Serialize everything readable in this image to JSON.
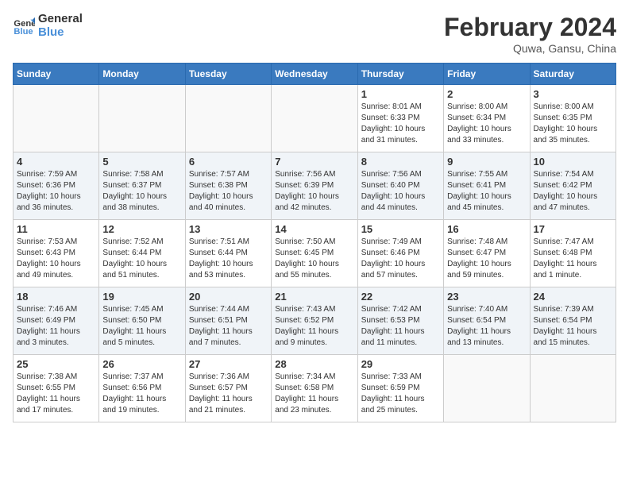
{
  "header": {
    "logo_line1": "General",
    "logo_line2": "Blue",
    "month_year": "February 2024",
    "location": "Quwa, Gansu, China"
  },
  "days_of_week": [
    "Sunday",
    "Monday",
    "Tuesday",
    "Wednesday",
    "Thursday",
    "Friday",
    "Saturday"
  ],
  "weeks": [
    [
      {
        "day": "",
        "info": ""
      },
      {
        "day": "",
        "info": ""
      },
      {
        "day": "",
        "info": ""
      },
      {
        "day": "",
        "info": ""
      },
      {
        "day": "1",
        "info": "Sunrise: 8:01 AM\nSunset: 6:33 PM\nDaylight: 10 hours\nand 31 minutes."
      },
      {
        "day": "2",
        "info": "Sunrise: 8:00 AM\nSunset: 6:34 PM\nDaylight: 10 hours\nand 33 minutes."
      },
      {
        "day": "3",
        "info": "Sunrise: 8:00 AM\nSunset: 6:35 PM\nDaylight: 10 hours\nand 35 minutes."
      }
    ],
    [
      {
        "day": "4",
        "info": "Sunrise: 7:59 AM\nSunset: 6:36 PM\nDaylight: 10 hours\nand 36 minutes."
      },
      {
        "day": "5",
        "info": "Sunrise: 7:58 AM\nSunset: 6:37 PM\nDaylight: 10 hours\nand 38 minutes."
      },
      {
        "day": "6",
        "info": "Sunrise: 7:57 AM\nSunset: 6:38 PM\nDaylight: 10 hours\nand 40 minutes."
      },
      {
        "day": "7",
        "info": "Sunrise: 7:56 AM\nSunset: 6:39 PM\nDaylight: 10 hours\nand 42 minutes."
      },
      {
        "day": "8",
        "info": "Sunrise: 7:56 AM\nSunset: 6:40 PM\nDaylight: 10 hours\nand 44 minutes."
      },
      {
        "day": "9",
        "info": "Sunrise: 7:55 AM\nSunset: 6:41 PM\nDaylight: 10 hours\nand 45 minutes."
      },
      {
        "day": "10",
        "info": "Sunrise: 7:54 AM\nSunset: 6:42 PM\nDaylight: 10 hours\nand 47 minutes."
      }
    ],
    [
      {
        "day": "11",
        "info": "Sunrise: 7:53 AM\nSunset: 6:43 PM\nDaylight: 10 hours\nand 49 minutes."
      },
      {
        "day": "12",
        "info": "Sunrise: 7:52 AM\nSunset: 6:44 PM\nDaylight: 10 hours\nand 51 minutes."
      },
      {
        "day": "13",
        "info": "Sunrise: 7:51 AM\nSunset: 6:44 PM\nDaylight: 10 hours\nand 53 minutes."
      },
      {
        "day": "14",
        "info": "Sunrise: 7:50 AM\nSunset: 6:45 PM\nDaylight: 10 hours\nand 55 minutes."
      },
      {
        "day": "15",
        "info": "Sunrise: 7:49 AM\nSunset: 6:46 PM\nDaylight: 10 hours\nand 57 minutes."
      },
      {
        "day": "16",
        "info": "Sunrise: 7:48 AM\nSunset: 6:47 PM\nDaylight: 10 hours\nand 59 minutes."
      },
      {
        "day": "17",
        "info": "Sunrise: 7:47 AM\nSunset: 6:48 PM\nDaylight: 11 hours\nand 1 minute."
      }
    ],
    [
      {
        "day": "18",
        "info": "Sunrise: 7:46 AM\nSunset: 6:49 PM\nDaylight: 11 hours\nand 3 minutes."
      },
      {
        "day": "19",
        "info": "Sunrise: 7:45 AM\nSunset: 6:50 PM\nDaylight: 11 hours\nand 5 minutes."
      },
      {
        "day": "20",
        "info": "Sunrise: 7:44 AM\nSunset: 6:51 PM\nDaylight: 11 hours\nand 7 minutes."
      },
      {
        "day": "21",
        "info": "Sunrise: 7:43 AM\nSunset: 6:52 PM\nDaylight: 11 hours\nand 9 minutes."
      },
      {
        "day": "22",
        "info": "Sunrise: 7:42 AM\nSunset: 6:53 PM\nDaylight: 11 hours\nand 11 minutes."
      },
      {
        "day": "23",
        "info": "Sunrise: 7:40 AM\nSunset: 6:54 PM\nDaylight: 11 hours\nand 13 minutes."
      },
      {
        "day": "24",
        "info": "Sunrise: 7:39 AM\nSunset: 6:54 PM\nDaylight: 11 hours\nand 15 minutes."
      }
    ],
    [
      {
        "day": "25",
        "info": "Sunrise: 7:38 AM\nSunset: 6:55 PM\nDaylight: 11 hours\nand 17 minutes."
      },
      {
        "day": "26",
        "info": "Sunrise: 7:37 AM\nSunset: 6:56 PM\nDaylight: 11 hours\nand 19 minutes."
      },
      {
        "day": "27",
        "info": "Sunrise: 7:36 AM\nSunset: 6:57 PM\nDaylight: 11 hours\nand 21 minutes."
      },
      {
        "day": "28",
        "info": "Sunrise: 7:34 AM\nSunset: 6:58 PM\nDaylight: 11 hours\nand 23 minutes."
      },
      {
        "day": "29",
        "info": "Sunrise: 7:33 AM\nSunset: 6:59 PM\nDaylight: 11 hours\nand 25 minutes."
      },
      {
        "day": "",
        "info": ""
      },
      {
        "day": "",
        "info": ""
      }
    ]
  ]
}
